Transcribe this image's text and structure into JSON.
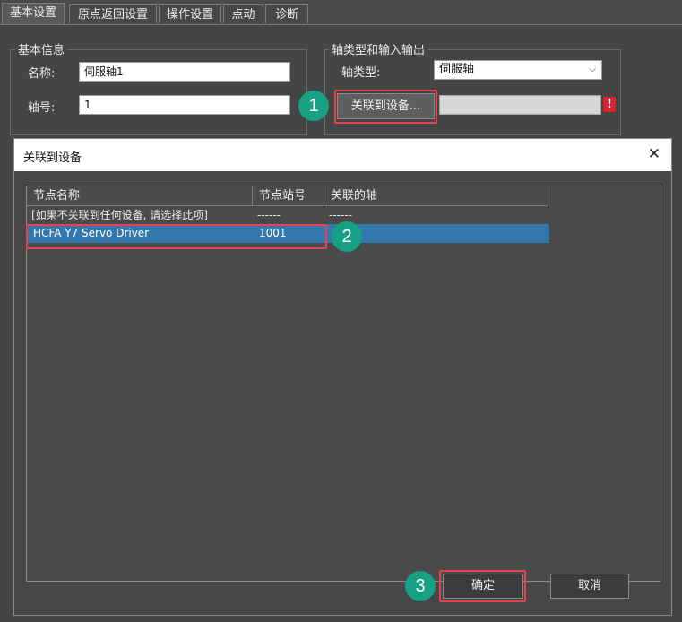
{
  "tabs": [
    {
      "label": "基本设置",
      "active": true
    },
    {
      "label": "原点返回设置",
      "active": false
    },
    {
      "label": "操作设置",
      "active": false
    },
    {
      "label": "点动",
      "active": false
    },
    {
      "label": "诊断",
      "active": false
    }
  ],
  "basic_info": {
    "title": "基本信息",
    "name_label": "名称:",
    "name_value": "伺服轴1",
    "axis_no_label": "轴号:",
    "axis_no_value": "1"
  },
  "axis_io": {
    "title": "轴类型和输入输出",
    "axis_type_label": "轴类型:",
    "axis_type_value": "伺服轴",
    "link_button_label": "关联到设备...",
    "link_value": "",
    "warning_glyph": "!"
  },
  "dialog": {
    "title": "关联到设备",
    "close_glyph": "✕",
    "columns": [
      "节点名称",
      "节点站号",
      "关联的轴"
    ],
    "rows": [
      {
        "node_name": "[如果不关联到任何设备, 请选择此项]",
        "station": "------",
        "axis": "------",
        "selected": false
      },
      {
        "node_name": "HCFA Y7 Servo Driver",
        "station": "1001",
        "axis": "",
        "selected": true
      }
    ],
    "ok_label": "确定",
    "cancel_label": "取消"
  },
  "markers": [
    "1",
    "2",
    "3"
  ],
  "colors": {
    "accent_marker": "#17a085",
    "highlight": "#e8424d",
    "selection": "#3178ae",
    "warning": "#e0202a"
  }
}
